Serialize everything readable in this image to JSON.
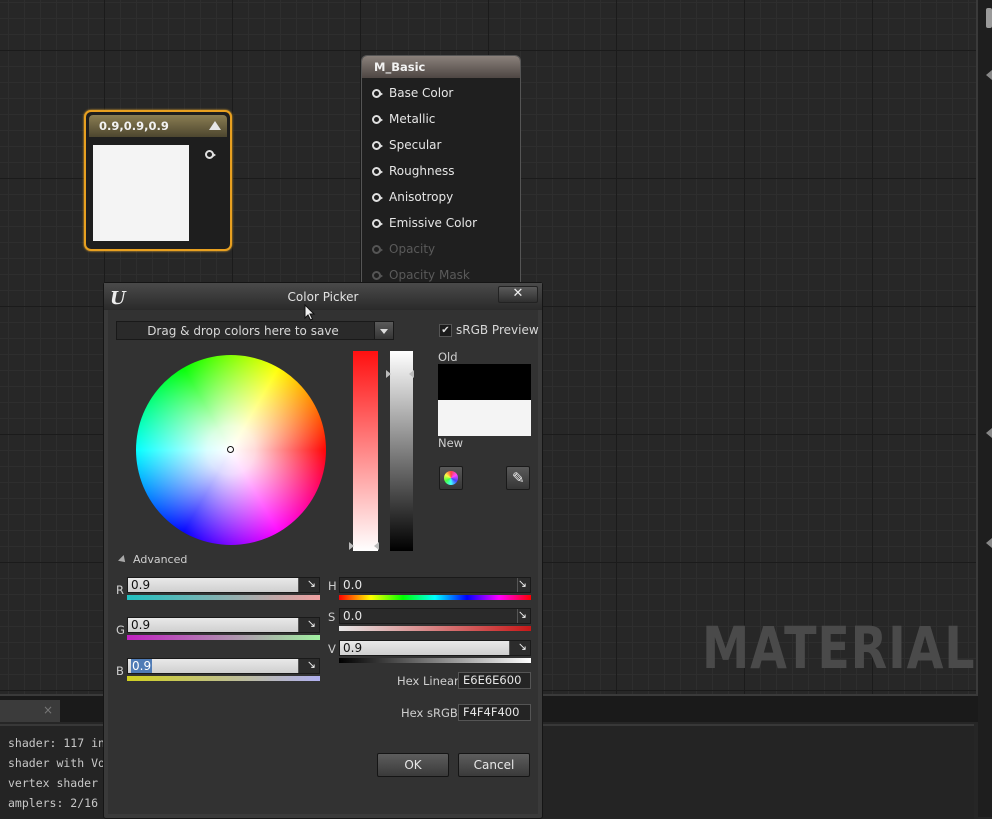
{
  "graph": {
    "watermark": "MATERIAL"
  },
  "constant_node": {
    "title": "0.9,0.9,0.9",
    "swatch_color": "#f4f4f4"
  },
  "material_node": {
    "title": "M_Basic",
    "inputs": [
      {
        "label": "Base Color",
        "enabled": true
      },
      {
        "label": "Metallic",
        "enabled": true
      },
      {
        "label": "Specular",
        "enabled": true
      },
      {
        "label": "Roughness",
        "enabled": true
      },
      {
        "label": "Anisotropy",
        "enabled": true
      },
      {
        "label": "Emissive Color",
        "enabled": true
      },
      {
        "label": "Opacity",
        "enabled": false
      },
      {
        "label": "Opacity Mask",
        "enabled": false
      }
    ]
  },
  "log": {
    "tab_close": "×",
    "lines": [
      "shader: 117 in",
      "shader with Vo",
      "vertex shader",
      "amplers: 2/16"
    ]
  },
  "color_picker": {
    "logo": "U",
    "title": "Color Picker",
    "close_label": "✕",
    "themes_placeholder": "Drag & drop colors here to save",
    "srgb_preview_label": "sRGB Preview",
    "srgb_preview_checked": true,
    "old_label": "Old",
    "new_label": "New",
    "old_color": "#000000",
    "new_color": "#f4f4f4",
    "advanced_label": "Advanced",
    "channels": {
      "r": {
        "label": "R",
        "value": "0.9"
      },
      "g": {
        "label": "G",
        "value": "0.9"
      },
      "b": {
        "label": "B",
        "value": "0.9"
      },
      "h": {
        "label": "H",
        "value": "0.0"
      },
      "s": {
        "label": "S",
        "value": "0.0"
      },
      "v": {
        "label": "V",
        "value": "0.9"
      }
    },
    "hex_linear_label": "Hex Linear",
    "hex_linear_value": "E6E6E600",
    "hex_srgb_label": "Hex sRGB",
    "hex_srgb_value": "F4F4F400",
    "ok_label": "OK",
    "cancel_label": "Cancel"
  }
}
